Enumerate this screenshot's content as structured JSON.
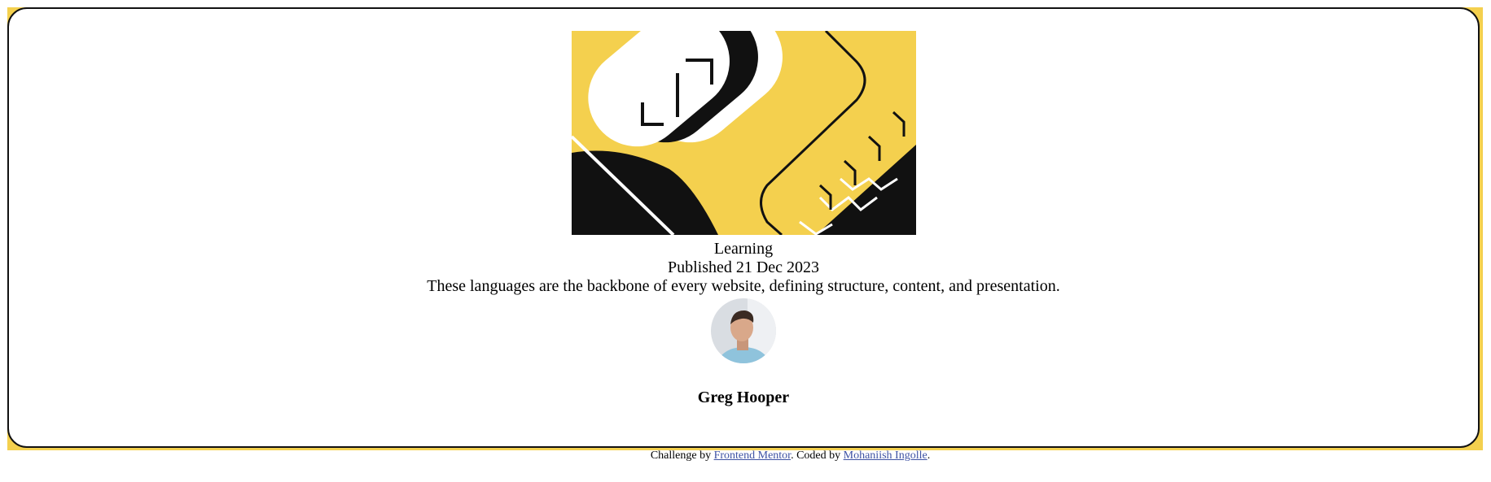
{
  "card": {
    "category": "Learning",
    "published": "Published 21 Dec 2023",
    "excerpt": "These languages are the backbone of every website, defining structure, content, and presentation.",
    "author": "Greg Hooper"
  },
  "attribution": {
    "prefix": "Challenge by ",
    "challenge_link": "Frontend Mentor",
    "middle": ". Coded by ",
    "coder_link": "Mohaniish Ingolle",
    "suffix": "."
  },
  "colors": {
    "accent_yellow": "#f4d04e",
    "ink": "#111111",
    "link": "#3e52a3"
  },
  "icons": {
    "hero": "abstract-html-illustration",
    "avatar": "author-photo"
  }
}
